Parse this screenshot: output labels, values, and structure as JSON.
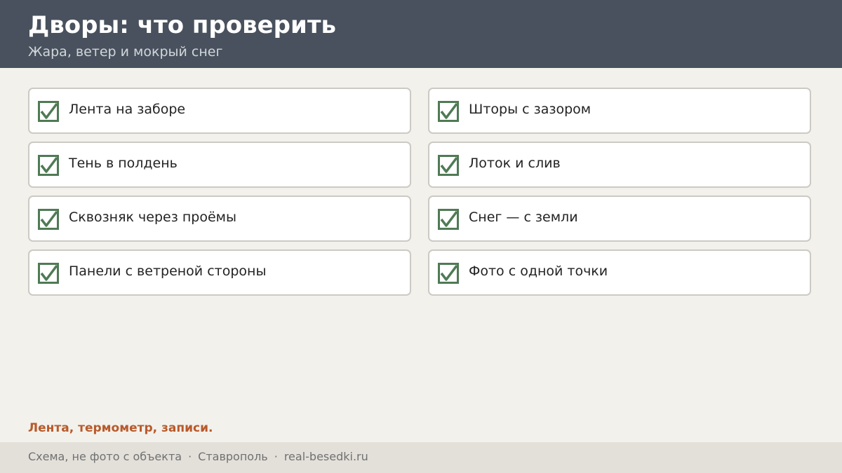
{
  "header": {
    "title": "Дворы: что проверить",
    "subtitle": "Жара, ветер и мокрый снег"
  },
  "checklist": [
    {
      "label": "Лента на заборе",
      "checked": true
    },
    {
      "label": "Шторы с зазором",
      "checked": true
    },
    {
      "label": "Тень в полдень",
      "checked": true
    },
    {
      "label": "Лоток и слив",
      "checked": true
    },
    {
      "label": "Сквозняк через проёмы",
      "checked": true
    },
    {
      "label": "Снег — с земли",
      "checked": true
    },
    {
      "label": "Панели с ветреной стороны",
      "checked": true
    },
    {
      "label": "Фото с одной точки",
      "checked": true
    }
  ],
  "note": "Лента, термометр, записи.",
  "footer": {
    "disclaimer": "Схема, не фото с объекта",
    "separator": "·",
    "city": "Ставрополь",
    "site": "real-besedki.ru"
  },
  "colors": {
    "header_bg": "#48515d",
    "check_green": "#4f7a55",
    "accent_orange": "#b85a2b",
    "page_bg": "#f3f1ec"
  },
  "icons": {
    "check": "checkbox-checked-icon"
  }
}
